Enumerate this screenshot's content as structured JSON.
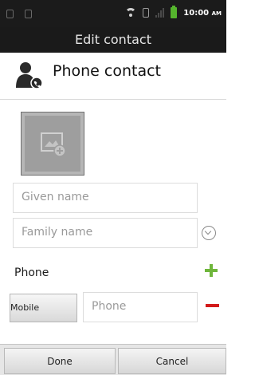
{
  "status_bar": {
    "time": "10:00",
    "ampm": "AM",
    "icons": [
      "usb-icon",
      "sd-icon",
      "wifi-icon",
      "sim-icon",
      "signal-icon",
      "battery-icon"
    ]
  },
  "header": {
    "title": "Edit contact"
  },
  "account": {
    "name": "Phone contact",
    "icon": "contact-person-icon"
  },
  "photo": {
    "icon": "add-photo-icon"
  },
  "fields": {
    "given_name_placeholder": "Given name",
    "family_name_placeholder": "Family name"
  },
  "phone_section": {
    "label": "Phone",
    "type_label": "Mobile",
    "number_placeholder": "Phone"
  },
  "buttons": {
    "done": "Done",
    "cancel": "Cancel"
  },
  "colors": {
    "add": "#6fb63c",
    "remove": "#d21a1a",
    "bar": "#1a1a1a"
  }
}
